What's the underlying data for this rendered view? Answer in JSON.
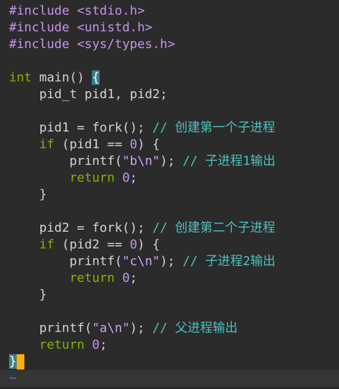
{
  "lines": {
    "l1": {
      "directive": "#include",
      "header": "<stdio.h>"
    },
    "l2": {
      "directive": "#include",
      "header": "<unistd.h>"
    },
    "l3": {
      "directive": "#include",
      "header": "<sys/types.h>"
    },
    "l5": {
      "type": "int",
      "name": " main()",
      "brace": "{"
    },
    "l6": {
      "text": "    pid_t pid1, pid2;"
    },
    "l8": {
      "code": "    pid1 = fork(); ",
      "comment": "// 创建第一个子进程"
    },
    "l9": {
      "kw": "    if",
      "open": " (pid1 == ",
      "num": "0",
      "close": ") {"
    },
    "l10": {
      "call": "        printf(",
      "str": "\"b\\n\"",
      "end": "); ",
      "comment": "// 子进程1输出"
    },
    "l11": {
      "kw": "        return ",
      "num": "0",
      "end": ";"
    },
    "l12": {
      "text": "    }"
    },
    "l14": {
      "code": "    pid2 = fork(); ",
      "comment": "// 创建第二个子进程"
    },
    "l15": {
      "kw": "    if",
      "open": " (pid2 == ",
      "num": "0",
      "close": ") {"
    },
    "l16": {
      "call": "        printf(",
      "str": "\"c\\n\"",
      "end": "); ",
      "comment": "// 子进程2输出"
    },
    "l17": {
      "kw": "        return ",
      "num": "0",
      "end": ";"
    },
    "l18": {
      "text": "    }"
    },
    "l20": {
      "call": "    printf(",
      "str": "\"a\\n\"",
      "end": "); ",
      "comment": "// 父进程输出"
    },
    "l21": {
      "kw": "    return ",
      "num": "0",
      "end": ";"
    },
    "l22": {
      "brace": "}"
    }
  },
  "tilde": "~",
  "colors": {
    "cursor": "#ffb000",
    "keyword": "#86b300",
    "comment": "#4fc1c1",
    "preprocessor": "#c792ea"
  }
}
